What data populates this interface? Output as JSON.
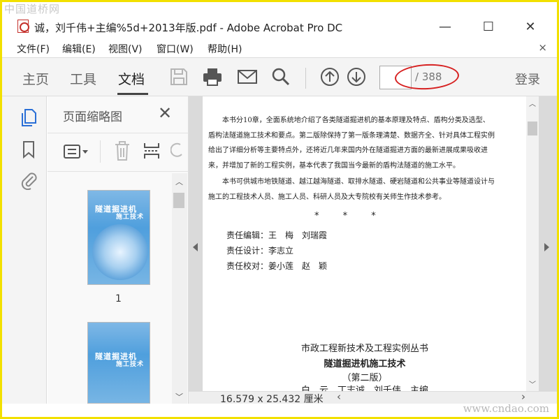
{
  "watermark": {
    "top": "中国道桥网",
    "bottom": "www.cndao.com"
  },
  "window": {
    "title": "诚，刘千伟+主编%5d+2013年版.pdf - Adobe Acrobat Pro DC",
    "minimize": "—",
    "maximize": "☐",
    "close": "✕"
  },
  "menu": {
    "items": [
      "文件(F)",
      "编辑(E)",
      "视图(V)",
      "窗口(W)",
      "帮助(H)"
    ],
    "close": "×"
  },
  "toolbar": {
    "tabs": [
      "主页",
      "工具",
      "文档"
    ],
    "active_tab": "文档",
    "page_input_value": "",
    "page_total": "/ 388",
    "login_label": "登录",
    "icons": [
      "save-icon",
      "print-icon",
      "mail-icon",
      "search-icon",
      "page-up-icon",
      "page-down-icon"
    ]
  },
  "thumbnails_panel": {
    "title": "页面缩略图",
    "close": "✕",
    "thumb1_label": "1",
    "cover_title": "隧道掘进机",
    "cover_subtitle": "施工技术"
  },
  "document": {
    "para1": "本书分10章，全面系统地介绍了各类隧道掘进机的基本原理及特点、盾构分类及选型、盾构法隧道施工技术和要点。第二版除保持了第一版条理清楚、数据齐全、针对具体工程实例给出了详细分析等主要特点外，还将近几年来国内外在隧道掘进方面的最新进展成果吸收进来，并增加了新的工程实例，基本代表了我国当今最新的盾构法隧道的施工水平。",
    "para2": "本书可供城市地铁隧道、越江越海隧道、取排水隧道、硬岩隧道和公共事业等隧道设计与施工的工程技术人员、施工人员、科研人员及大专院校有关师生作技术参考。",
    "stars": "* * *",
    "credits": [
      "责任编辑：王　梅　刘瑞霞",
      "责任设计：李志立",
      "责任校对：姜小莲　赵　颖"
    ],
    "series_title": "市政工程新技术及工程实例丛书",
    "book_title": "隧道掘进机施工技术",
    "edition": "（第二版）",
    "authors_partial": "白　云　丁志诚　刘千伟　主编"
  },
  "statusbar": {
    "page_size": "16.579 x 25.432 厘米"
  },
  "colors": {
    "annotation_red": "#d62020",
    "frame_yellow": "#f2e000",
    "cover_blue": "#4f9fdd"
  }
}
